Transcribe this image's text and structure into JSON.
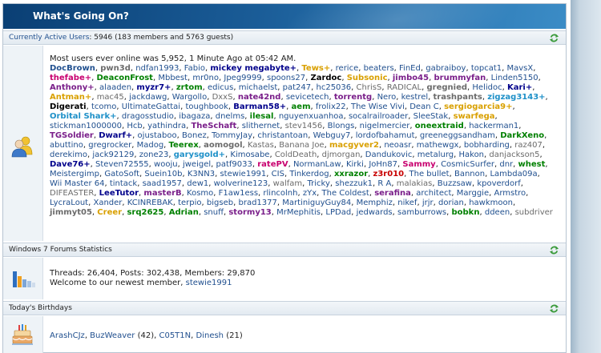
{
  "header": {
    "title": "What's Going On?"
  },
  "active_users": {
    "link": "Currently Active Users",
    "count": ": 5946 (183 members and 5763 guests)",
    "most_online": "Most users ever online was 5,952, 1 Minute Ago at 05:42 AM.",
    "users": [
      {
        "n": "DocBrown",
        "c": "#21508f",
        "b": true,
        "s": ","
      },
      {
        "n": "pwn3d",
        "c": "#6b6b6b",
        "b": true,
        "s": ","
      },
      {
        "n": "ndfan1993",
        "c": "#21508f",
        "b": false,
        "s": ","
      },
      {
        "n": "Fabio",
        "c": "#21508f",
        "b": false,
        "s": ","
      },
      {
        "n": "mickey megabyte+",
        "c": "#00008b",
        "b": true,
        "s": ","
      },
      {
        "n": "Tews+",
        "c": "#d9a000",
        "b": true,
        "s": ","
      },
      {
        "n": "rerice",
        "c": "#21508f",
        "b": false,
        "s": ","
      },
      {
        "n": "beaters",
        "c": "#21508f",
        "b": false,
        "s": ","
      },
      {
        "n": "FinEd",
        "c": "#21508f",
        "b": false,
        "s": ","
      },
      {
        "n": "gabraiboy",
        "c": "#21508f",
        "b": false,
        "s": ","
      },
      {
        "n": "topcat1",
        "c": "#21508f",
        "b": false,
        "s": ","
      },
      {
        "n": "MavsX",
        "c": "#21508f",
        "b": false,
        "s": ","
      },
      {
        "n": "thefabe+",
        "c": "#c8006f",
        "b": true,
        "s": ","
      },
      {
        "n": "DeaconFrost",
        "c": "#008000",
        "b": true,
        "s": ","
      },
      {
        "n": "Mbbest",
        "c": "#21508f",
        "b": false,
        "s": ","
      },
      {
        "n": "mr0no",
        "c": "#21508f",
        "b": false,
        "s": ","
      },
      {
        "n": "Jpeg9999",
        "c": "#21508f",
        "b": false,
        "s": ","
      },
      {
        "n": "spoons27",
        "c": "#21508f",
        "b": false,
        "s": ","
      },
      {
        "n": "Zardoc",
        "c": "#000000",
        "b": true,
        "s": ","
      },
      {
        "n": "Subsonic",
        "c": "#d9a000",
        "b": true,
        "s": ","
      },
      {
        "n": "jimbo45",
        "c": "#7a1f8a",
        "b": true,
        "s": ","
      },
      {
        "n": "brummyfan",
        "c": "#7a1f8a",
        "b": true,
        "s": ","
      },
      {
        "n": "Linden5150",
        "c": "#21508f",
        "b": false,
        "s": ","
      },
      {
        "n": "Anthony+",
        "c": "#7a1f8a",
        "b": true,
        "s": ","
      },
      {
        "n": "alaaden",
        "c": "#21508f",
        "b": false,
        "s": ","
      },
      {
        "n": "myzr7+",
        "c": "#00008b",
        "b": true,
        "s": ","
      },
      {
        "n": "zrtom",
        "c": "#008000",
        "b": true,
        "s": ","
      },
      {
        "n": "edicus",
        "c": "#21508f",
        "b": false,
        "s": ","
      },
      {
        "n": "michaelst",
        "c": "#21508f",
        "b": false,
        "s": ","
      },
      {
        "n": "pat247",
        "c": "#21508f",
        "b": false,
        "s": ","
      },
      {
        "n": "hc25036",
        "c": "#21508f",
        "b": false,
        "s": ","
      },
      {
        "n": "ChrisS",
        "c": "#6b6b6b",
        "b": false,
        "s": ","
      },
      {
        "n": "RADICAL",
        "c": "#6b6b6b",
        "b": false,
        "s": ","
      },
      {
        "n": "gregnied",
        "c": "#6b6b6b",
        "b": true,
        "s": ","
      },
      {
        "n": "Helidoc",
        "c": "#21508f",
        "b": false,
        "s": ","
      },
      {
        "n": "Kari+",
        "c": "#00008b",
        "b": true,
        "s": ","
      },
      {
        "n": "Antman+",
        "c": "#d9a000",
        "b": true,
        "s": ","
      },
      {
        "n": "mac45",
        "c": "#6b6b6b",
        "b": false,
        "s": ","
      },
      {
        "n": "jackdawg",
        "c": "#21508f",
        "b": false,
        "s": ","
      },
      {
        "n": "Wargollo",
        "c": "#21508f",
        "b": false,
        "s": ","
      },
      {
        "n": "DxxS",
        "c": "#6b6b6b",
        "b": false,
        "s": ","
      },
      {
        "n": "nate42nd",
        "c": "#7a1f8a",
        "b": true,
        "s": ","
      },
      {
        "n": "sevicetech",
        "c": "#21508f",
        "b": false,
        "s": ","
      },
      {
        "n": "torrentg",
        "c": "#7a1f8a",
        "b": true,
        "s": ","
      },
      {
        "n": "Nero",
        "c": "#21508f",
        "b": false,
        "s": ","
      },
      {
        "n": "kestrel",
        "c": "#21508f",
        "b": false,
        "s": ","
      },
      {
        "n": "trashpants",
        "c": "#6b6b6b",
        "b": true,
        "s": ","
      },
      {
        "n": "zigzag3143+",
        "c": "#1e90c8",
        "b": true,
        "s": ","
      },
      {
        "n": "Digerati",
        "c": "#000000",
        "b": true,
        "s": ","
      },
      {
        "n": "tcomo",
        "c": "#21508f",
        "b": false,
        "s": ","
      },
      {
        "n": "UltimateGattai",
        "c": "#21508f",
        "b": false,
        "s": ","
      },
      {
        "n": "toughbook",
        "c": "#21508f",
        "b": false,
        "s": ","
      },
      {
        "n": "Barman58+",
        "c": "#00008b",
        "b": true,
        "s": ","
      },
      {
        "n": "aem",
        "c": "#008000",
        "b": true,
        "s": ","
      },
      {
        "n": "frolix22",
        "c": "#21508f",
        "b": false,
        "s": ","
      },
      {
        "n": "The Wise Vivi",
        "c": "#21508f",
        "b": false,
        "s": ","
      },
      {
        "n": "Dean C",
        "c": "#21508f",
        "b": false,
        "s": ","
      },
      {
        "n": "sergiogarcia9+",
        "c": "#d9a000",
        "b": true,
        "s": ","
      },
      {
        "n": "Orbital Shark+",
        "c": "#1e90c8",
        "b": true,
        "s": ","
      },
      {
        "n": "dragosstudio",
        "c": "#21508f",
        "b": false,
        "s": ","
      },
      {
        "n": "ibagaza",
        "c": "#21508f",
        "b": false,
        "s": ","
      },
      {
        "n": "dnelms",
        "c": "#21508f",
        "b": false,
        "s": ","
      },
      {
        "n": "ilesal",
        "c": "#008000",
        "b": true,
        "s": ","
      },
      {
        "n": "nguyenxuanhoa",
        "c": "#21508f",
        "b": false,
        "s": ","
      },
      {
        "n": "socalrailroader",
        "c": "#21508f",
        "b": false,
        "s": ","
      },
      {
        "n": "SleeStak",
        "c": "#21508f",
        "b": false,
        "s": ","
      },
      {
        "n": "swarfega",
        "c": "#d9a000",
        "b": true,
        "s": ","
      },
      {
        "n": "stickman1000000",
        "c": "#21508f",
        "b": false,
        "s": ","
      },
      {
        "n": "Hcb",
        "c": "#21508f",
        "b": false,
        "s": ","
      },
      {
        "n": "yathindra",
        "c": "#21508f",
        "b": false,
        "s": ","
      },
      {
        "n": "TheSchaft",
        "c": "#7a1f8a",
        "b": true,
        "s": ","
      },
      {
        "n": "slithernet",
        "c": "#21508f",
        "b": false,
        "s": ","
      },
      {
        "n": "stev1456",
        "c": "#6b6b6b",
        "b": false,
        "s": ","
      },
      {
        "n": "Blongs",
        "c": "#21508f",
        "b": false,
        "s": ","
      },
      {
        "n": "nigelmercier",
        "c": "#21508f",
        "b": false,
        "s": ","
      },
      {
        "n": "oneextraid",
        "c": "#008000",
        "b": true,
        "s": ","
      },
      {
        "n": "hackerman1",
        "c": "#21508f",
        "b": false,
        "s": ","
      },
      {
        "n": "TGSoldier",
        "c": "#7a1f8a",
        "b": true,
        "s": ","
      },
      {
        "n": "Dwarf+",
        "c": "#00008b",
        "b": true,
        "s": ","
      },
      {
        "n": "ojustaboo",
        "c": "#21508f",
        "b": false,
        "s": ","
      },
      {
        "n": "Bonez",
        "c": "#21508f",
        "b": false,
        "s": ","
      },
      {
        "n": "TommyJay",
        "c": "#21508f",
        "b": false,
        "s": ","
      },
      {
        "n": "christantoan",
        "c": "#21508f",
        "b": false,
        "s": ","
      },
      {
        "n": "Webguy7",
        "c": "#21508f",
        "b": false,
        "s": ","
      },
      {
        "n": "lordofbahamut",
        "c": "#21508f",
        "b": false,
        "s": ","
      },
      {
        "n": "greeneggsandham",
        "c": "#21508f",
        "b": false,
        "s": ","
      },
      {
        "n": "DarkXeno",
        "c": "#008000",
        "b": true,
        "s": ","
      },
      {
        "n": "abuttino",
        "c": "#21508f",
        "b": false,
        "s": ","
      },
      {
        "n": "gregrocker",
        "c": "#21508f",
        "b": false,
        "s": ","
      },
      {
        "n": "Madog",
        "c": "#21508f",
        "b": false,
        "s": ","
      },
      {
        "n": "Teerex",
        "c": "#008000",
        "b": true,
        "s": ","
      },
      {
        "n": "aomogol",
        "c": "#6b6b6b",
        "b": true,
        "s": ","
      },
      {
        "n": "Kastas",
        "c": "#6b6b6b",
        "b": false,
        "s": ","
      },
      {
        "n": "Banana Joe",
        "c": "#6b6b6b",
        "b": false,
        "s": ","
      },
      {
        "n": "macgyver2",
        "c": "#d9a000",
        "b": true,
        "s": ","
      },
      {
        "n": "neoasr",
        "c": "#21508f",
        "b": false,
        "s": ","
      },
      {
        "n": "mathewgx",
        "c": "#21508f",
        "b": false,
        "s": ","
      },
      {
        "n": "bobharding",
        "c": "#21508f",
        "b": false,
        "s": ","
      },
      {
        "n": "raz407",
        "c": "#6b6b6b",
        "b": false,
        "s": ","
      },
      {
        "n": "derekimo",
        "c": "#21508f",
        "b": false,
        "s": ","
      },
      {
        "n": "jack92129",
        "c": "#21508f",
        "b": false,
        "s": ","
      },
      {
        "n": "zone23",
        "c": "#21508f",
        "b": false,
        "s": ","
      },
      {
        "n": "garysgold+",
        "c": "#1e90c8",
        "b": true,
        "s": ","
      },
      {
        "n": "Kimosabe",
        "c": "#21508f",
        "b": false,
        "s": ","
      },
      {
        "n": "ColdDeath",
        "c": "#6b6b6b",
        "b": false,
        "s": ","
      },
      {
        "n": "djmorgan",
        "c": "#6b6b6b",
        "b": false,
        "s": ","
      },
      {
        "n": "Dandukovic",
        "c": "#21508f",
        "b": false,
        "s": ","
      },
      {
        "n": "metalurg",
        "c": "#21508f",
        "b": false,
        "s": ","
      },
      {
        "n": "Hakon",
        "c": "#21508f",
        "b": false,
        "s": ","
      },
      {
        "n": "danjackson5",
        "c": "#6b6b6b",
        "b": false,
        "s": ","
      },
      {
        "n": "Dave76+",
        "c": "#00008b",
        "b": true,
        "s": ","
      },
      {
        "n": "Steven72555",
        "c": "#21508f",
        "b": false,
        "s": ","
      },
      {
        "n": "wooju",
        "c": "#21508f",
        "b": false,
        "s": ","
      },
      {
        "n": "jweigel",
        "c": "#21508f",
        "b": false,
        "s": ","
      },
      {
        "n": "patf9033",
        "c": "#21508f",
        "b": false,
        "s": ","
      },
      {
        "n": "ratePV",
        "c": "#c8006f",
        "b": true,
        "s": ","
      },
      {
        "n": "NormanLaw",
        "c": "#21508f",
        "b": false,
        "s": ","
      },
      {
        "n": "Kirki",
        "c": "#21508f",
        "b": false,
        "s": ","
      },
      {
        "n": "JoHn87",
        "c": "#21508f",
        "b": false,
        "s": ","
      },
      {
        "n": "Sammy",
        "c": "#c8006f",
        "b": true,
        "s": ","
      },
      {
        "n": "CosmicSurfer",
        "c": "#21508f",
        "b": false,
        "s": ","
      },
      {
        "n": "dnr",
        "c": "#21508f",
        "b": false,
        "s": ","
      },
      {
        "n": "whest",
        "c": "#008000",
        "b": true,
        "s": ","
      },
      {
        "n": "Meistergimp",
        "c": "#21508f",
        "b": false,
        "s": ","
      },
      {
        "n": "GatoSoft",
        "c": "#21508f",
        "b": false,
        "s": ","
      },
      {
        "n": "Suein10b",
        "c": "#21508f",
        "b": false,
        "s": ","
      },
      {
        "n": "K3NN3",
        "c": "#21508f",
        "b": false,
        "s": ","
      },
      {
        "n": "stewie1991",
        "c": "#21508f",
        "b": false,
        "s": ","
      },
      {
        "n": "CIS",
        "c": "#21508f",
        "b": false,
        "s": ","
      },
      {
        "n": "Tinkerdog",
        "c": "#21508f",
        "b": false,
        "s": ","
      },
      {
        "n": "xxrazor",
        "c": "#008000",
        "b": true,
        "s": ","
      },
      {
        "n": "z3r010",
        "c": "#c80000",
        "b": true,
        "s": ","
      },
      {
        "n": "The bullet",
        "c": "#21508f",
        "b": false,
        "s": ","
      },
      {
        "n": "Bannon",
        "c": "#21508f",
        "b": false,
        "s": ","
      },
      {
        "n": "Lambda09a",
        "c": "#21508f",
        "b": false,
        "s": ","
      },
      {
        "n": "Wii Master 64",
        "c": "#21508f",
        "b": false,
        "s": ","
      },
      {
        "n": "tintack",
        "c": "#21508f",
        "b": false,
        "s": ","
      },
      {
        "n": "saad1957",
        "c": "#21508f",
        "b": false,
        "s": ","
      },
      {
        "n": "dew1",
        "c": "#21508f",
        "b": false,
        "s": ","
      },
      {
        "n": "wolverine123",
        "c": "#21508f",
        "b": false,
        "s": ","
      },
      {
        "n": "walfam",
        "c": "#6b6b6b",
        "b": false,
        "s": ","
      },
      {
        "n": "Tricky",
        "c": "#21508f",
        "b": false,
        "s": ","
      },
      {
        "n": "shezzuk1",
        "c": "#21508f",
        "b": false,
        "s": ","
      },
      {
        "n": "R A",
        "c": "#21508f",
        "b": false,
        "s": ","
      },
      {
        "n": "malakias",
        "c": "#6b6b6b",
        "b": false,
        "s": ","
      },
      {
        "n": "Buzzsaw",
        "c": "#21508f",
        "b": false,
        "s": ","
      },
      {
        "n": "kpoverdorf",
        "c": "#21508f",
        "b": false,
        "s": ","
      },
      {
        "n": "DIFEASTER",
        "c": "#6b6b6b",
        "b": false,
        "s": ","
      },
      {
        "n": "LeeTutor",
        "c": "#00008b",
        "b": true,
        "s": ","
      },
      {
        "n": "masterB",
        "c": "#7a1f8a",
        "b": true,
        "s": ","
      },
      {
        "n": "Kosmo",
        "c": "#21508f",
        "b": false,
        "s": ","
      },
      {
        "n": "F1aw1ess",
        "c": "#21508f",
        "b": false,
        "s": ","
      },
      {
        "n": "rlincolnh",
        "c": "#21508f",
        "b": false,
        "s": ","
      },
      {
        "n": "zYx",
        "c": "#21508f",
        "b": false,
        "s": ","
      },
      {
        "n": "The Coldest",
        "c": "#21508f",
        "b": false,
        "s": ","
      },
      {
        "n": "serafina",
        "c": "#7a1f8a",
        "b": true,
        "s": ","
      },
      {
        "n": "architect",
        "c": "#21508f",
        "b": false,
        "s": ","
      },
      {
        "n": "Marggie",
        "c": "#21508f",
        "b": false,
        "s": ","
      },
      {
        "n": "Armstro",
        "c": "#21508f",
        "b": false,
        "s": ","
      },
      {
        "n": "LycraLout",
        "c": "#21508f",
        "b": false,
        "s": ","
      },
      {
        "n": "Xander",
        "c": "#21508f",
        "b": false,
        "s": ","
      },
      {
        "n": "KCINREBAK",
        "c": "#21508f",
        "b": false,
        "s": ","
      },
      {
        "n": "terpio",
        "c": "#21508f",
        "b": false,
        "s": ","
      },
      {
        "n": "bigseb",
        "c": "#21508f",
        "b": false,
        "s": ","
      },
      {
        "n": "brad1377",
        "c": "#21508f",
        "b": false,
        "s": ","
      },
      {
        "n": "MartiniguyGuy84",
        "c": "#21508f",
        "b": false,
        "s": ","
      },
      {
        "n": "Memphiz",
        "c": "#21508f",
        "b": false,
        "s": ","
      },
      {
        "n": "nikef",
        "c": "#21508f",
        "b": false,
        "s": ","
      },
      {
        "n": "jrjr",
        "c": "#21508f",
        "b": false,
        "s": ","
      },
      {
        "n": "dorian",
        "c": "#21508f",
        "b": false,
        "s": ","
      },
      {
        "n": "hawkmoon",
        "c": "#21508f",
        "b": false,
        "s": ","
      },
      {
        "n": "jimmyt05",
        "c": "#6b6b6b",
        "b": true,
        "s": ","
      },
      {
        "n": "Creer",
        "c": "#d9a000",
        "b": true,
        "s": ","
      },
      {
        "n": "srq2625",
        "c": "#008000",
        "b": true,
        "s": ","
      },
      {
        "n": "Adrian",
        "c": "#008000",
        "b": true,
        "s": ","
      },
      {
        "n": "snuff",
        "c": "#21508f",
        "b": false,
        "s": ","
      },
      {
        "n": "stormy13",
        "c": "#7a1f8a",
        "b": true,
        "s": ","
      },
      {
        "n": "MrMephitis",
        "c": "#21508f",
        "b": false,
        "s": ","
      },
      {
        "n": "LPDad",
        "c": "#21508f",
        "b": false,
        "s": ","
      },
      {
        "n": "jedwards",
        "c": "#21508f",
        "b": false,
        "s": ","
      },
      {
        "n": "samburrows",
        "c": "#21508f",
        "b": false,
        "s": ","
      },
      {
        "n": "bobkn",
        "c": "#008000",
        "b": true,
        "s": ","
      },
      {
        "n": "ddeen",
        "c": "#21508f",
        "b": false,
        "s": ","
      },
      {
        "n": "subdriver",
        "c": "#6b6b6b",
        "b": false,
        "s": ""
      }
    ]
  },
  "stats": {
    "label": "Windows 7 Forums Statistics",
    "line1": "Threads: 26,404, Posts: 302,438, Members: 29,870",
    "line2_prefix": "Welcome to our newest member, ",
    "newest_member": "stewie1991"
  },
  "birthdays": {
    "label": "Today's Birthdays",
    "people": [
      {
        "name": "ArashCJz",
        "age": ""
      },
      {
        "name": "BuzWeaver",
        "age": "(42)"
      },
      {
        "name": "C05T1N",
        "age": ""
      },
      {
        "name": "Dinesh",
        "age": "(21)"
      }
    ]
  },
  "colors": {
    "link": "#21508f",
    "header": "#1a5c97",
    "refresh_icon": "#3a9a3a"
  }
}
